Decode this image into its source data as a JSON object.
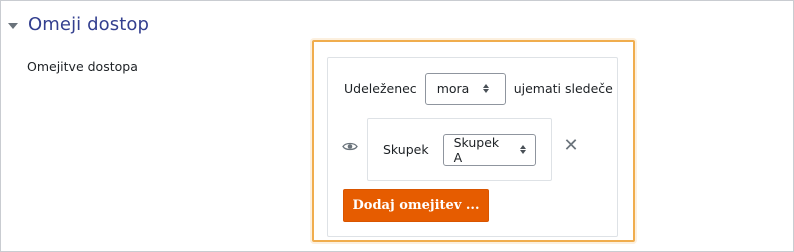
{
  "section": {
    "title": "Omeji dostop",
    "field_label": "Omejitve dostopa"
  },
  "restriction": {
    "prefix": "Udeleženec",
    "mode_select_value": "mora",
    "suffix": "ujemati sledeče",
    "condition": {
      "label": "Skupek",
      "select_value": "Skupek A"
    },
    "add_button_label": "Dodaj omejitev ..."
  },
  "colors": {
    "accent": "#e65c00",
    "title": "#333f8f",
    "focus": "#f0ad4e"
  }
}
